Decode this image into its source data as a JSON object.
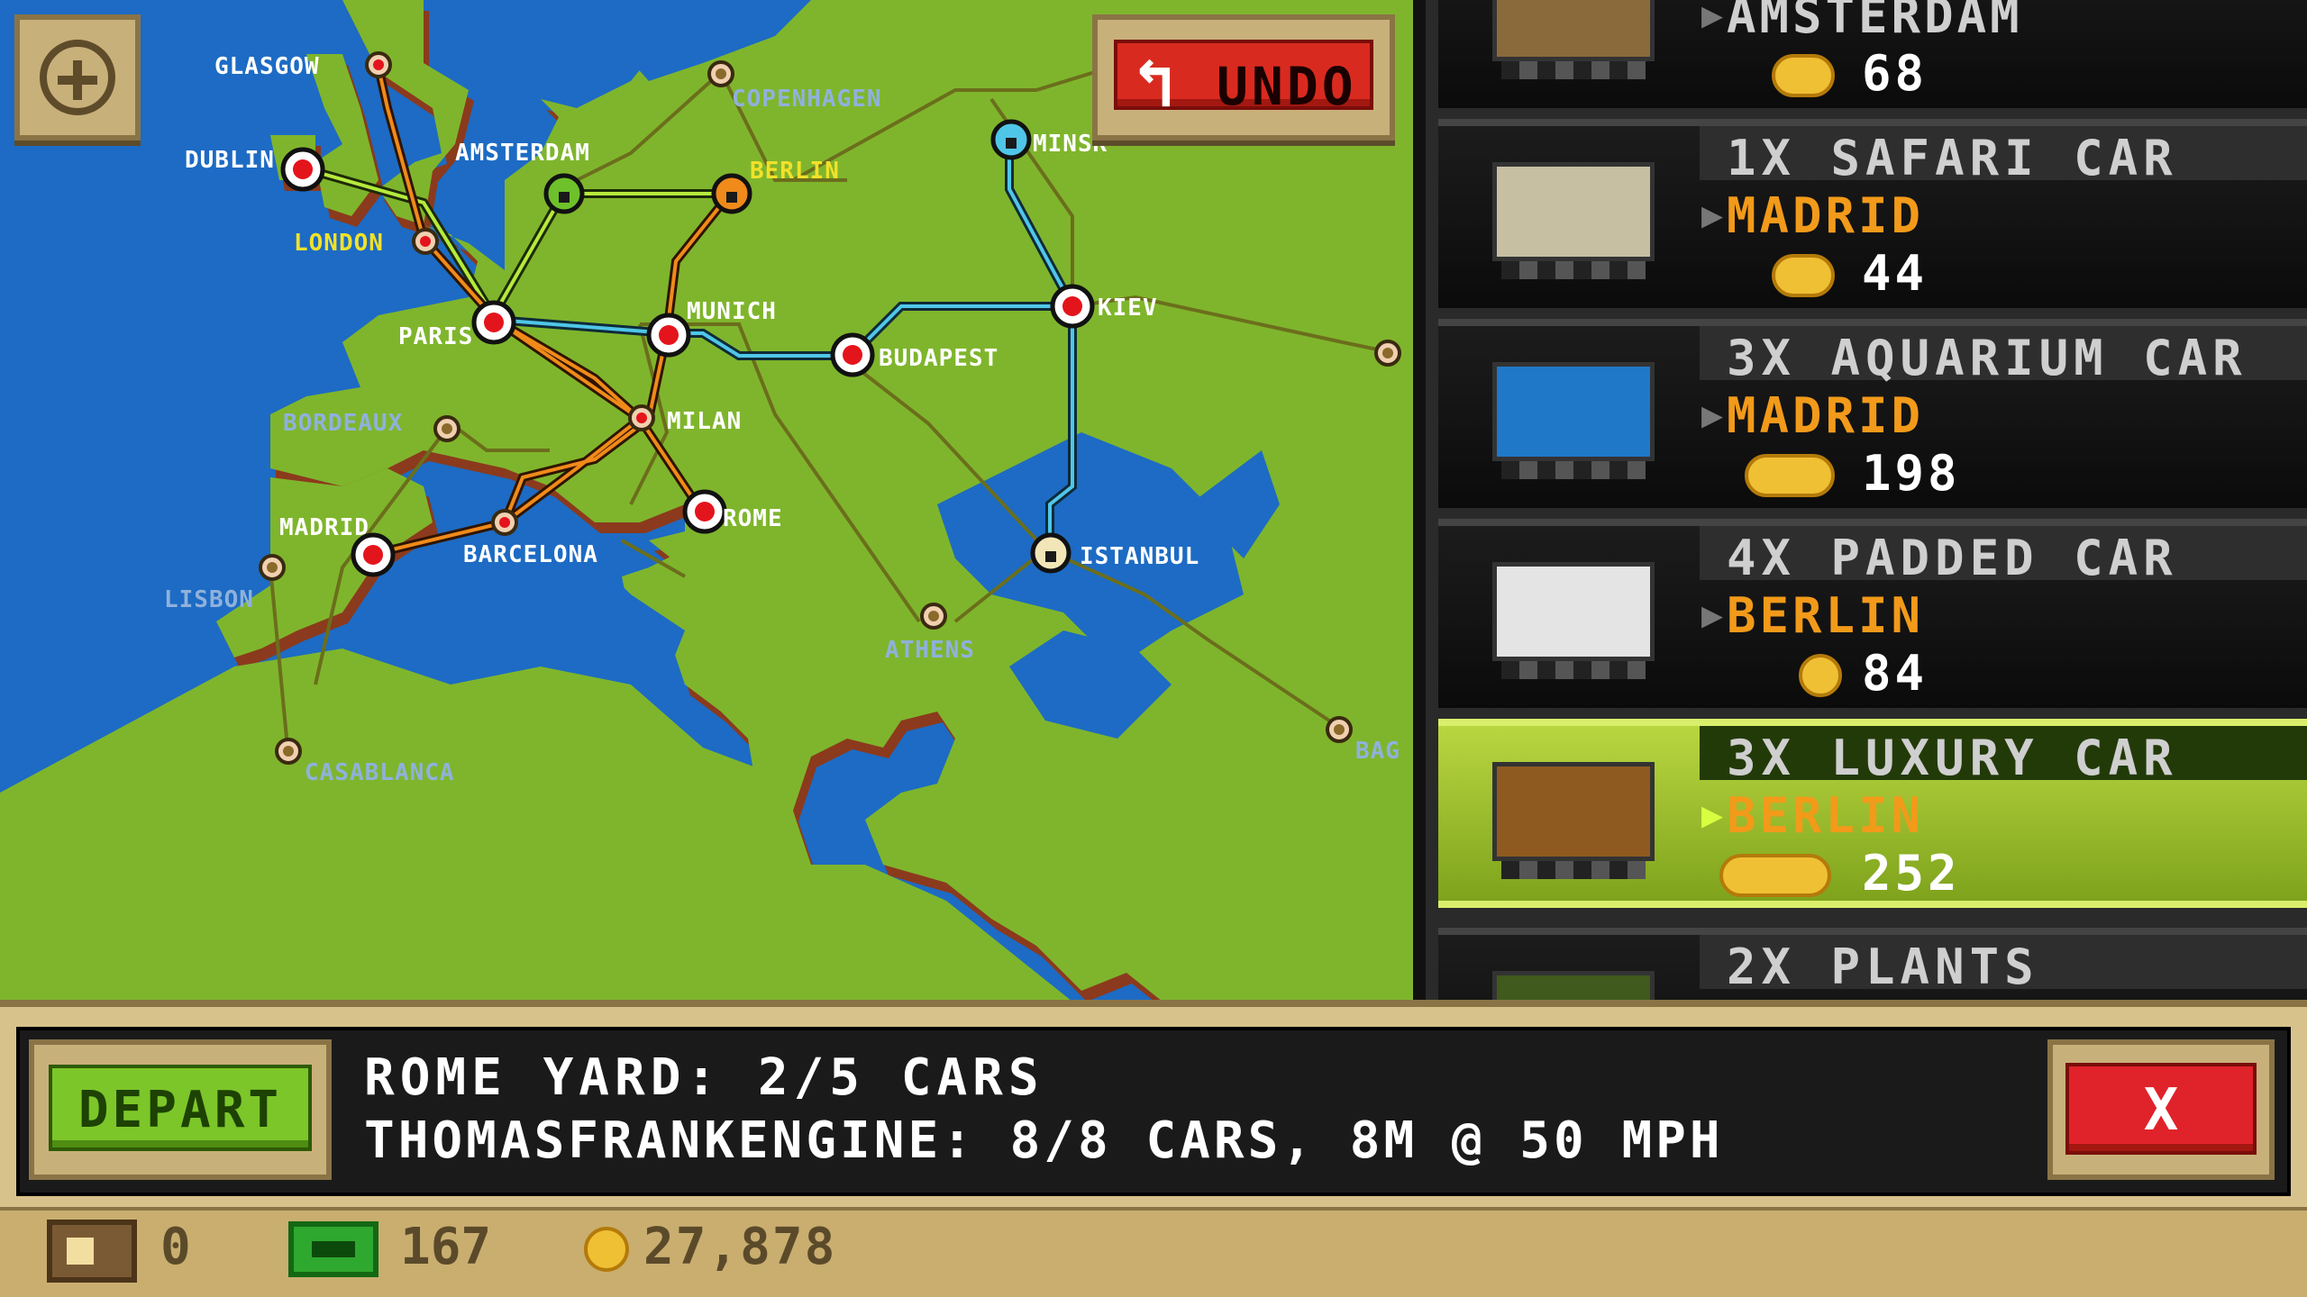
{
  "map": {
    "cities": {
      "glasgow": "GLASGOW",
      "dublin": "DUBLIN",
      "london": "LONDON",
      "amsterdam": "AMSTERDAM",
      "copenhagen": "COPENHAGEN",
      "berlin": "BERLIN",
      "minsk": "MINSK",
      "paris": "PARIS",
      "munich": "MUNICH",
      "kiev": "KIEV",
      "budapest": "BUDAPEST",
      "bordeaux": "BORDEAUX",
      "milan": "MILAN",
      "madrid": "MADRID",
      "barcelona": "BARCELONA",
      "rome": "ROME",
      "istanbul": "ISTANBUL",
      "lisbon": "LISBON",
      "athens": "ATHENS",
      "casablanca": "CASABLANCA",
      "bag": "BAG"
    }
  },
  "undo_label": "UNDO",
  "cars": [
    {
      "title": "",
      "dest": "AMSTERDAM",
      "value": "68"
    },
    {
      "title": "1X SAFARI CAR",
      "dest": "MADRID",
      "value": "44"
    },
    {
      "title": "3X AQUARIUM CAR",
      "dest": "MADRID",
      "value": "198"
    },
    {
      "title": "4X PADDED CAR",
      "dest": "BERLIN",
      "value": "84"
    },
    {
      "title": "3X LUXURY CAR",
      "dest": "BERLIN",
      "value": "252"
    },
    {
      "title": "2X PLANTS",
      "dest": "",
      "value": ""
    }
  ],
  "dialog": {
    "depart_label": "DEPART",
    "yard_line": "ROME YARD: 2/5 CARS",
    "engine_line": "THOMASFRANKENGINE: 8/8 CARS, 8M @ 50 MPH",
    "close_label": "X"
  },
  "status": {
    "crates": "0",
    "cash": "167",
    "coins": "27,878"
  },
  "colors": {
    "ocean": "#1d6bc4",
    "land": "#7fb52c",
    "orange_line": "#f08a1a",
    "cyan_line": "#4fc6e8",
    "selected_row": "#9cc232",
    "destination_text": "#f29a1a"
  }
}
